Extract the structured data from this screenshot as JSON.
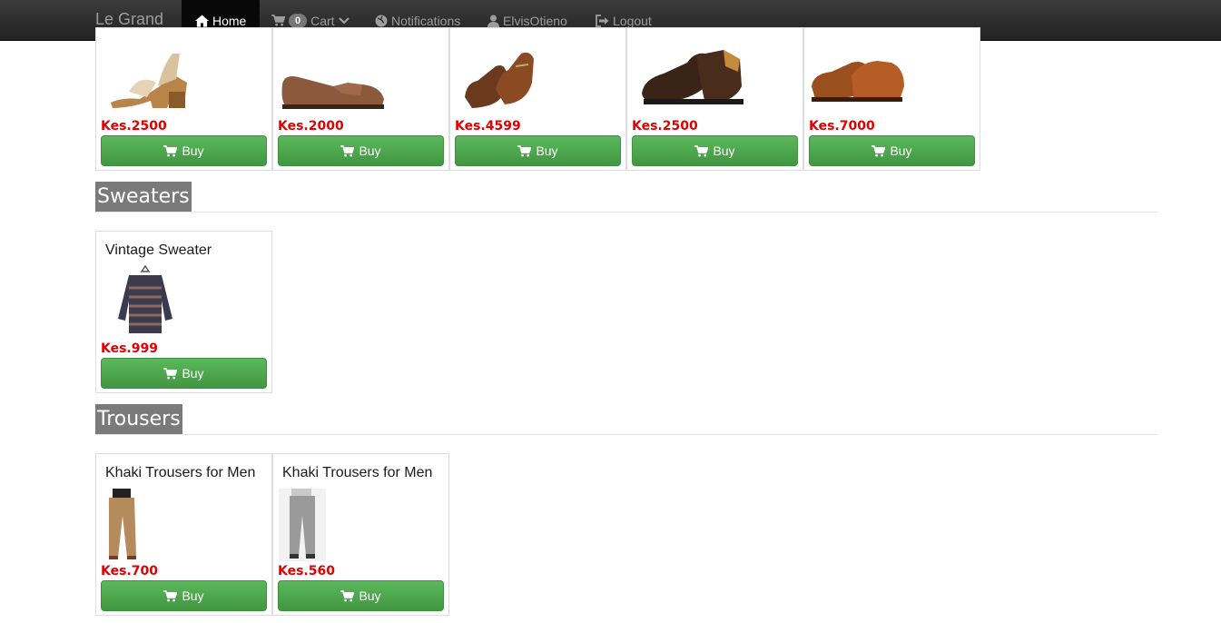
{
  "navbar": {
    "brand": "Le Grand",
    "items": [
      {
        "label": "Home",
        "icon": "home-icon",
        "active": true
      },
      {
        "label": "Cart",
        "icon": "cart-icon",
        "badge": "0"
      },
      {
        "label": "Notifications",
        "icon": "globe-icon"
      },
      {
        "label": "ElvisOtieno",
        "icon": "user-icon"
      },
      {
        "label": "Logout",
        "icon": "logout-icon"
      }
    ]
  },
  "shoes": [
    {
      "price": "Kes.2500",
      "buy": "Buy"
    },
    {
      "price": "Kes.2000",
      "buy": "Buy"
    },
    {
      "price": "Kes.4599",
      "buy": "Buy"
    },
    {
      "price": "Kes.2500",
      "buy": "Buy"
    },
    {
      "price": "Kes.7000",
      "buy": "Buy"
    }
  ],
  "sweaters": {
    "heading": "Sweaters",
    "products": [
      {
        "title": "Vintage Sweater",
        "price": "Kes.999",
        "buy": "Buy"
      }
    ]
  },
  "trousers": {
    "heading": "Trousers",
    "products": [
      {
        "title": "Khaki Trousers for Men",
        "price": "Kes.700",
        "buy": "Buy"
      },
      {
        "title": "Khaki Trousers for Men",
        "price": "Kes.560",
        "buy": "Buy"
      }
    ]
  },
  "colors": {
    "navbar": "#222222",
    "price": "#e00000",
    "buy_button": "#4cae4c",
    "heading_bg": "#7a7a7a"
  }
}
